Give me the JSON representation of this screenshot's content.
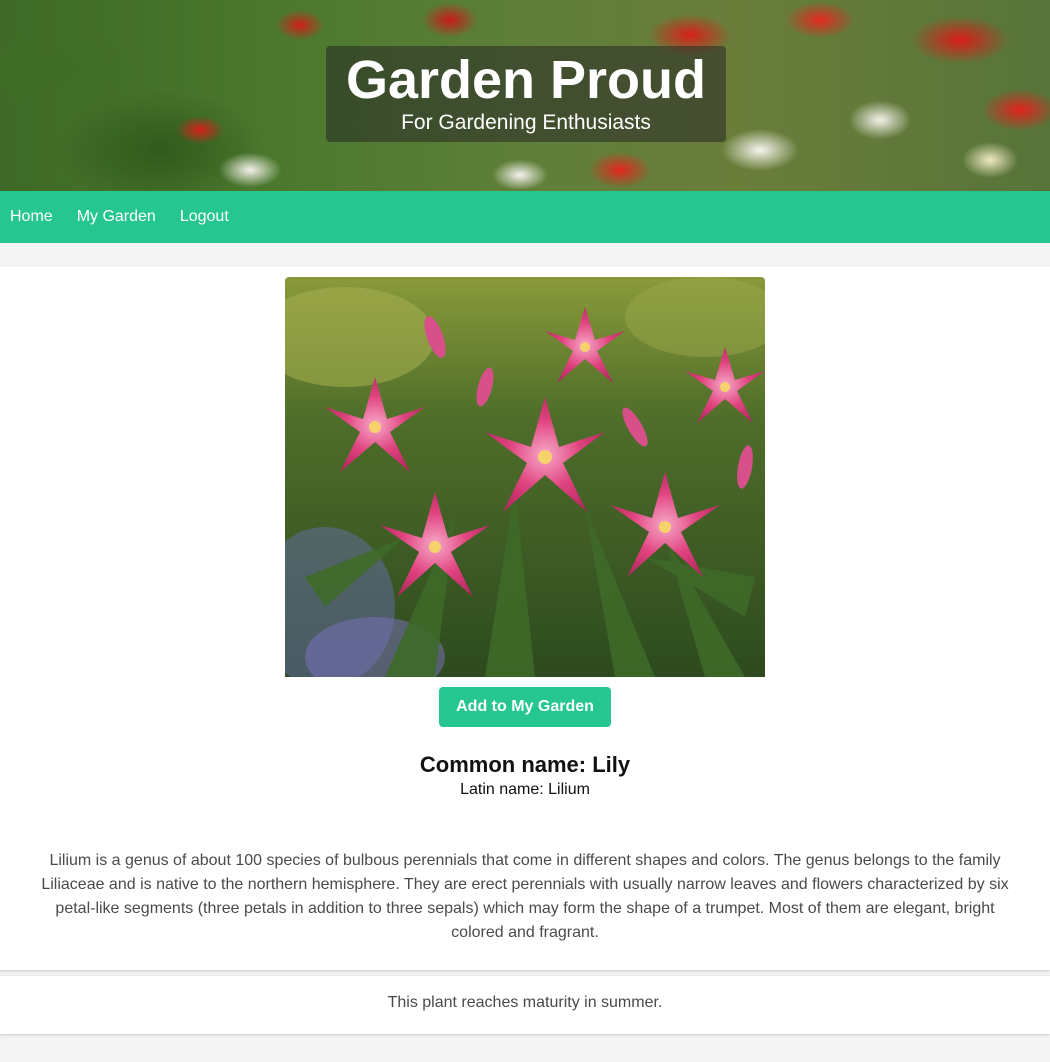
{
  "header": {
    "title": "Garden Proud",
    "subtitle": "For Gardening Enthusiasts"
  },
  "nav": {
    "items": [
      {
        "label": "Home"
      },
      {
        "label": "My Garden"
      },
      {
        "label": "Logout"
      }
    ]
  },
  "plant": {
    "image_alt": "Lily",
    "add_button_label": "Add to My Garden",
    "common_name": "Common name: Lily",
    "latin_name": "Latin name: Lilium",
    "description": "Lilium is a genus of about 100 species of bulbous perennials that come in different shapes and colors. The genus belongs to the family Liliaceae and is native to the northern hemisphere. They are erect perennials with usually narrow leaves and flowers characterized by six petal-like segments (three petals in addition to three sepals) which may form the shape of a trumpet. Most of them are elegant, bright colored and fragrant.",
    "maturity": "This plant reaches maturity in summer."
  },
  "colors": {
    "accent": "#26c690",
    "text": "#4a4a4a",
    "heading": "#111111"
  }
}
